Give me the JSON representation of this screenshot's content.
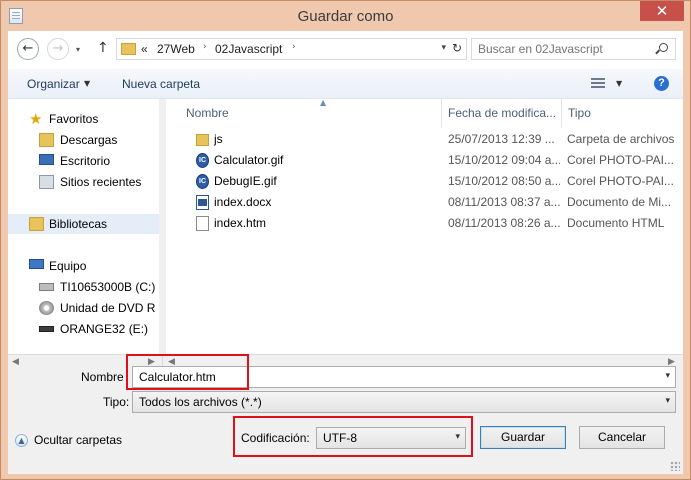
{
  "window": {
    "title": "Guardar como",
    "close_label": "✕"
  },
  "address": {
    "overflow": "«",
    "crumbs": [
      "27Web",
      "02Javascript"
    ],
    "search_placeholder": "Buscar en 02Javascript"
  },
  "toolbar": {
    "organize": "Organizar",
    "new_folder": "Nueva carpeta",
    "help": "?"
  },
  "nav": {
    "favorites": "Favoritos",
    "downloads": "Descargas",
    "desktop": "Escritorio",
    "recent": "Sitios recientes",
    "libraries": "Bibliotecas",
    "computer": "Equipo",
    "drive_c": "TI10653000B (C:)",
    "dvd": "Unidad de DVD R",
    "usb": "ORANGE32 (E:)"
  },
  "columns": {
    "name": "Nombre",
    "date": "Fecha de modifica...",
    "type": "Tipo"
  },
  "files": [
    {
      "name": "js",
      "date": "25/07/2013 12:39 ...",
      "type": "Carpeta de archivos",
      "icon": "folder-icon"
    },
    {
      "name": "Calculator.gif",
      "date": "15/10/2012 09:04 a...",
      "type": "Corel PHOTO-PAI...",
      "icon": "gif-icon"
    },
    {
      "name": "DebugIE.gif",
      "date": "15/10/2012 08:50 a...",
      "type": "Corel PHOTO-PAI...",
      "icon": "gif-icon"
    },
    {
      "name": "index.docx",
      "date": "08/11/2013 08:37 a...",
      "type": "Documento de Mi...",
      "icon": "docx-icon"
    },
    {
      "name": "index.htm",
      "date": "08/11/2013 08:26 a...",
      "type": "Documento HTML",
      "icon": "htm-icon"
    }
  ],
  "form": {
    "filename_label": "Nombre",
    "filename_value": "Calculator.htm",
    "type_label": "Tipo:",
    "type_value": "Todos los archivos  (*.*)",
    "encoding_label": "Codificación:",
    "encoding_value": "UTF-8",
    "save": "Guardar",
    "cancel": "Cancelar",
    "hide_folders": "Ocultar carpetas"
  },
  "colors": {
    "titlebar": "#f0c8ae",
    "highlight": "#e0101a",
    "close": "#c7504a"
  }
}
